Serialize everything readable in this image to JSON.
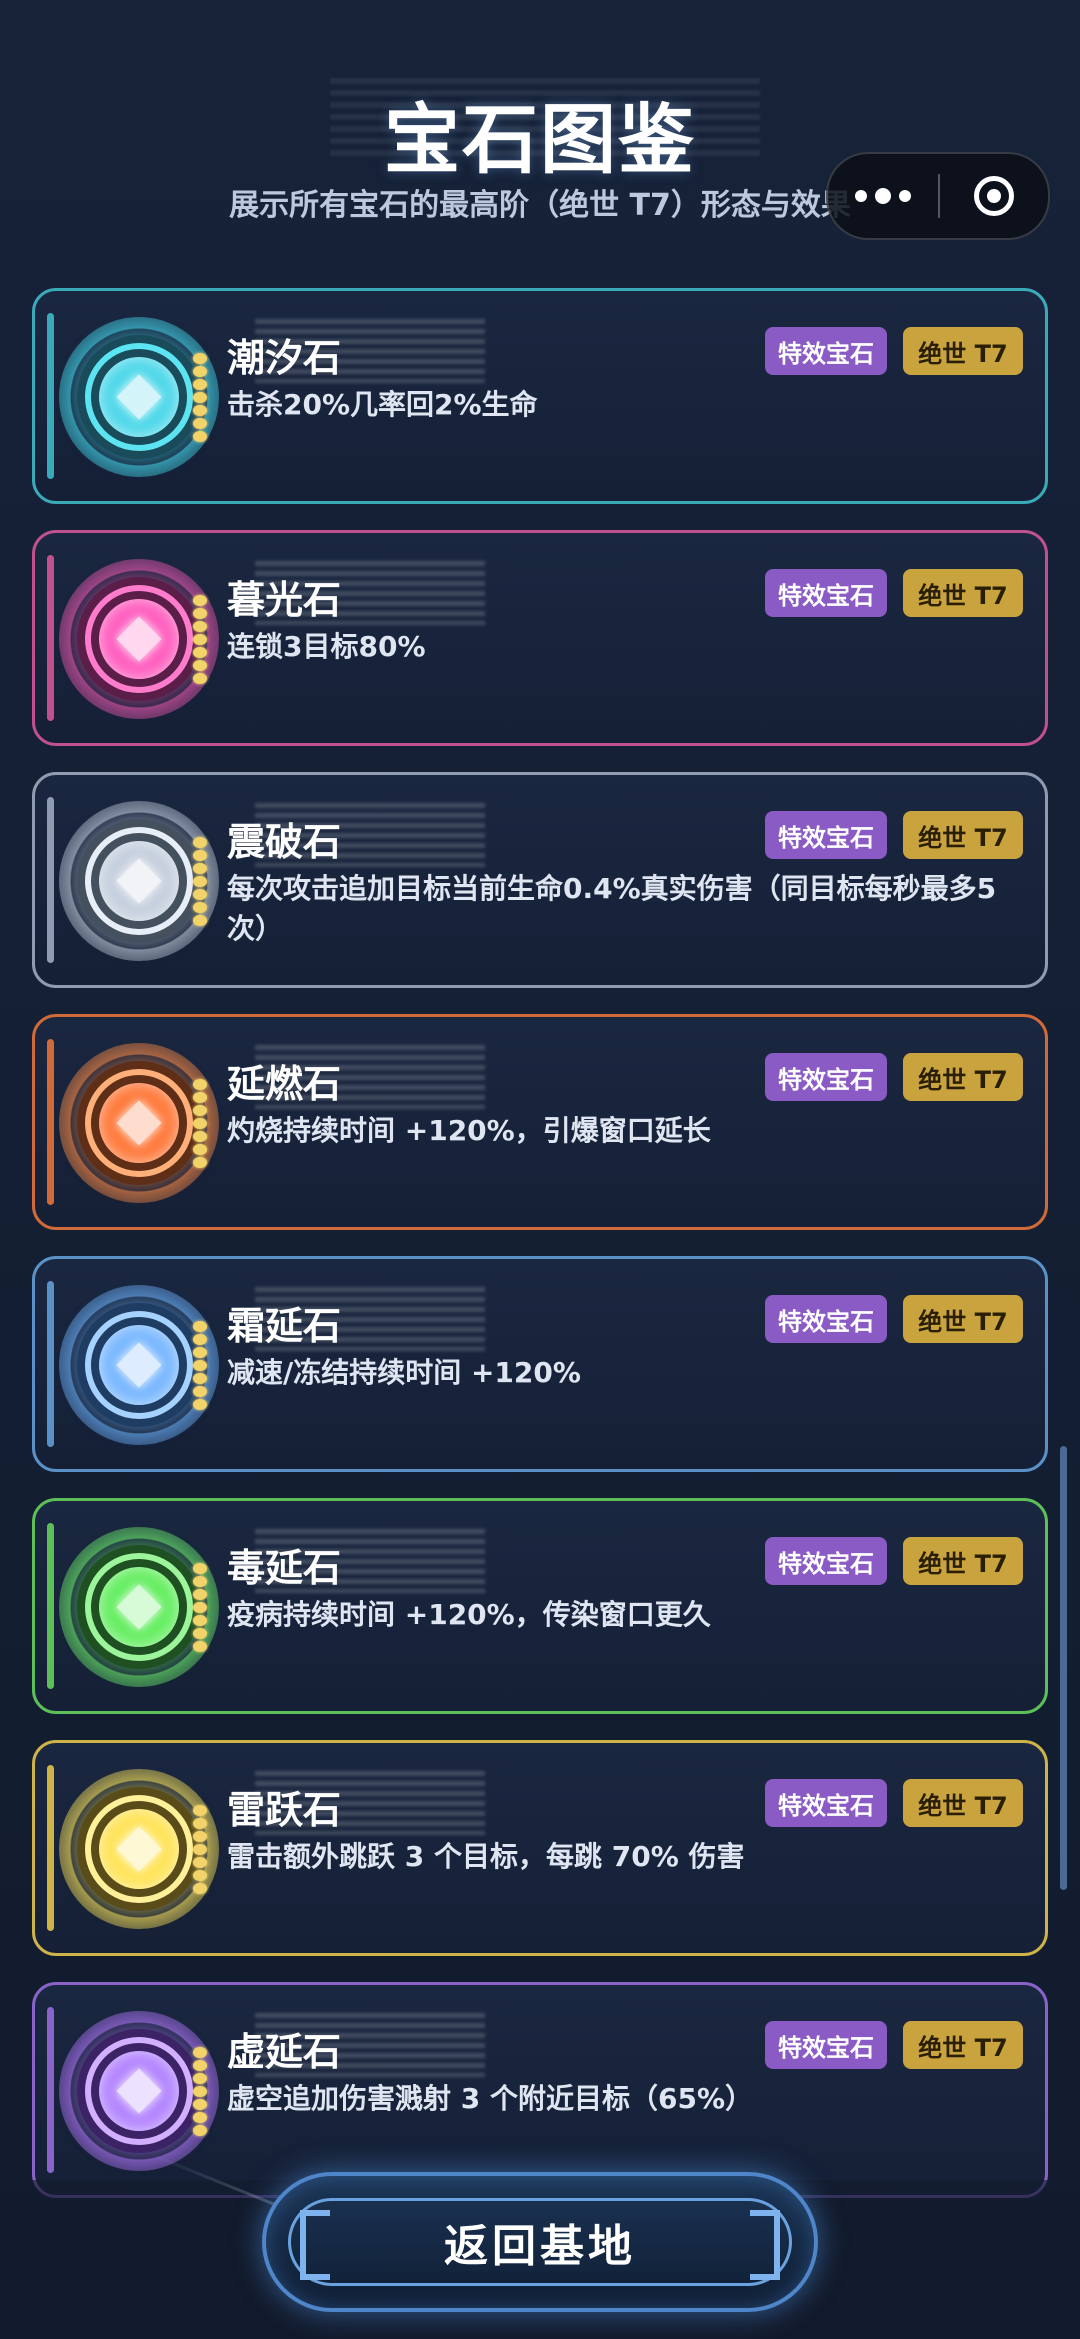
{
  "header": {
    "title": "宝石图鉴",
    "subtitle": "展示所有宝石的最高阶（绝世 T7）形态与效果"
  },
  "capsule": {
    "more_icon": "more-dots-icon",
    "close_icon": "target-close-icon"
  },
  "gems": [
    {
      "name": "潮汐石",
      "desc": "击杀20%几率回2%生命",
      "tag": "特效宝石",
      "tier": "绝世 T7",
      "color": "#3aa9b8"
    },
    {
      "name": "暮光石",
      "desc": "连锁3目标80%",
      "tag": "特效宝石",
      "tier": "绝世 T7",
      "color": "#c0508e"
    },
    {
      "name": "震破石",
      "desc": "每次攻击追加目标当前生命0.4%真实伤害（同目标每秒最多5次）",
      "tag": "特效宝石",
      "tier": "绝世 T7",
      "color": "#8e9bb0"
    },
    {
      "name": "延燃石",
      "desc": "灼烧持续时间 +120%，引爆窗口延长",
      "tag": "特效宝石",
      "tier": "绝世 T7",
      "color": "#d06a38"
    },
    {
      "name": "霜延石",
      "desc": "减速/冻结持续时间 +120%",
      "tag": "特效宝石",
      "tier": "绝世 T7",
      "color": "#5a92c8"
    },
    {
      "name": "毒延石",
      "desc": "疫病持续时间 +120%，传染窗口更久",
      "tag": "特效宝石",
      "tier": "绝世 T7",
      "color": "#5cbf58"
    },
    {
      "name": "雷跃石",
      "desc": "雷击额外跳跃 3 个目标，每跳 70% 伤害",
      "tag": "特效宝石",
      "tier": "绝世 T7",
      "color": "#cdb348"
    },
    {
      "name": "虚延石",
      "desc": "虚空追加伤害溅射 3 个附近目标（65%）",
      "tag": "特效宝石",
      "tier": "绝世 T7",
      "color": "#8a63c8"
    }
  ],
  "footer": {
    "back_label": "返回基地"
  }
}
